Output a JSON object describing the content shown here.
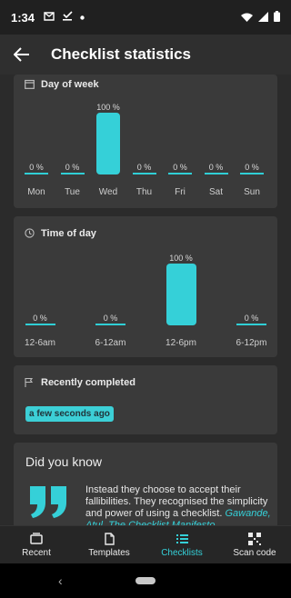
{
  "status": {
    "time": "1:34"
  },
  "appbar": {
    "title": "Checklist statistics"
  },
  "day_of_week": {
    "title": "Day of week",
    "unit": "%",
    "days": [
      {
        "label": "Mon",
        "pct": "0 %",
        "value": 0
      },
      {
        "label": "Tue",
        "pct": "0 %",
        "value": 0
      },
      {
        "label": "Wed",
        "pct": "100 %",
        "value": 100
      },
      {
        "label": "Thu",
        "pct": "0 %",
        "value": 0
      },
      {
        "label": "Fri",
        "pct": "0 %",
        "value": 0
      },
      {
        "label": "Sat",
        "pct": "0 %",
        "value": 0
      },
      {
        "label": "Sun",
        "pct": "0 %",
        "value": 0
      }
    ]
  },
  "time_of_day": {
    "title": "Time of day",
    "slots": [
      {
        "label": "12-6am",
        "pct": "0 %",
        "value": 0
      },
      {
        "label": "6-12am",
        "pct": "0 %",
        "value": 0
      },
      {
        "label": "12-6pm",
        "pct": "100 %",
        "value": 100
      },
      {
        "label": "6-12pm",
        "pct": "0 %",
        "value": 0
      }
    ]
  },
  "recently_completed": {
    "title": "Recently completed",
    "badge": "a few seconds ago"
  },
  "did_you_know": {
    "title": "Did you know",
    "quote": "Instead they choose to accept their fallibilities. They recognised the simplicity and power of using a checklist.",
    "source": "Gawande, Atul. The Checklist Manifesto"
  },
  "bottom_nav": [
    {
      "label": "Recent",
      "icon": "inbox-icon",
      "active": false
    },
    {
      "label": "Templates",
      "icon": "document-icon",
      "active": false
    },
    {
      "label": "Checklists",
      "icon": "list-icon",
      "active": true
    },
    {
      "label": "Scan code",
      "icon": "qr-code-icon",
      "active": false
    }
  ],
  "colors": {
    "accent": "#35d0d8",
    "card": "#3a3a3a",
    "background": "#2b2b2b"
  }
}
